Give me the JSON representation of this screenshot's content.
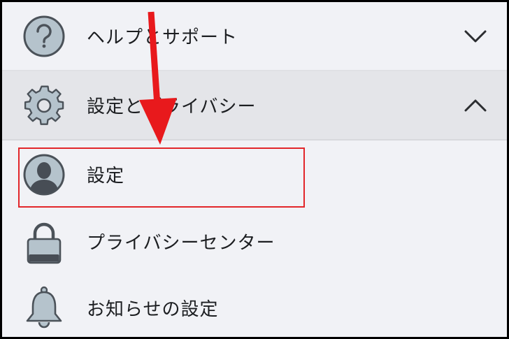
{
  "menu": {
    "help": {
      "label": "ヘルプとサポート",
      "icon": "question-circle-icon",
      "state": "collapsed"
    },
    "privacy": {
      "label": "設定とプライバシー",
      "icon": "gear-icon",
      "state": "expanded"
    },
    "settings": {
      "label": "設定",
      "icon": "profile-avatar-icon"
    },
    "privacy_center": {
      "label": "プライバシーセンター",
      "icon": "lock-icon"
    },
    "notifications": {
      "label": "お知らせの設定",
      "icon": "bell-icon"
    }
  },
  "annotation": {
    "arrow_color": "#e8191c",
    "highlight_color": "#e2262a"
  }
}
